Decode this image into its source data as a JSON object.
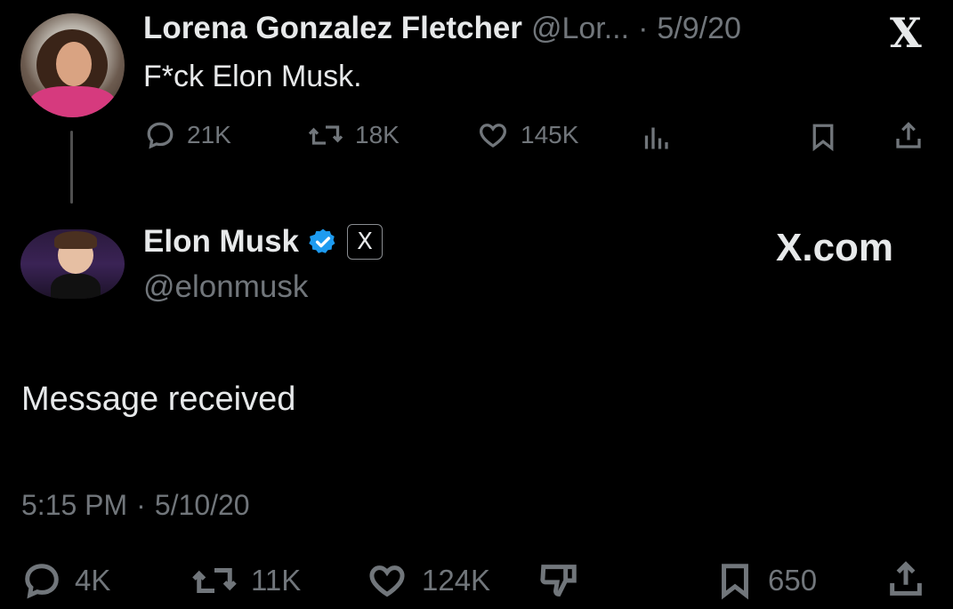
{
  "reply": {
    "author_name": "Lorena Gonzalez Fletcher",
    "handle": "@Lor...",
    "separator": "·",
    "date": "5/9/20",
    "text": "F*ck Elon Musk.",
    "metrics": {
      "replies": "21K",
      "reposts": "18K",
      "likes": "145K"
    }
  },
  "tweet": {
    "author_name": "Elon Musk",
    "handle": "@elonmusk",
    "badge_letter": "X",
    "brand": "X.com",
    "text": "Message received",
    "time": "5:15 PM",
    "separator": "·",
    "date": "5/10/20",
    "metrics": {
      "replies": "4K",
      "reposts": "11K",
      "likes": "124K",
      "bookmarks": "650"
    }
  },
  "corner_logo": "X",
  "colors": {
    "background": "#000000",
    "text": "#e7e9ea",
    "muted": "#71767b",
    "verified": "#1d9bf0"
  }
}
